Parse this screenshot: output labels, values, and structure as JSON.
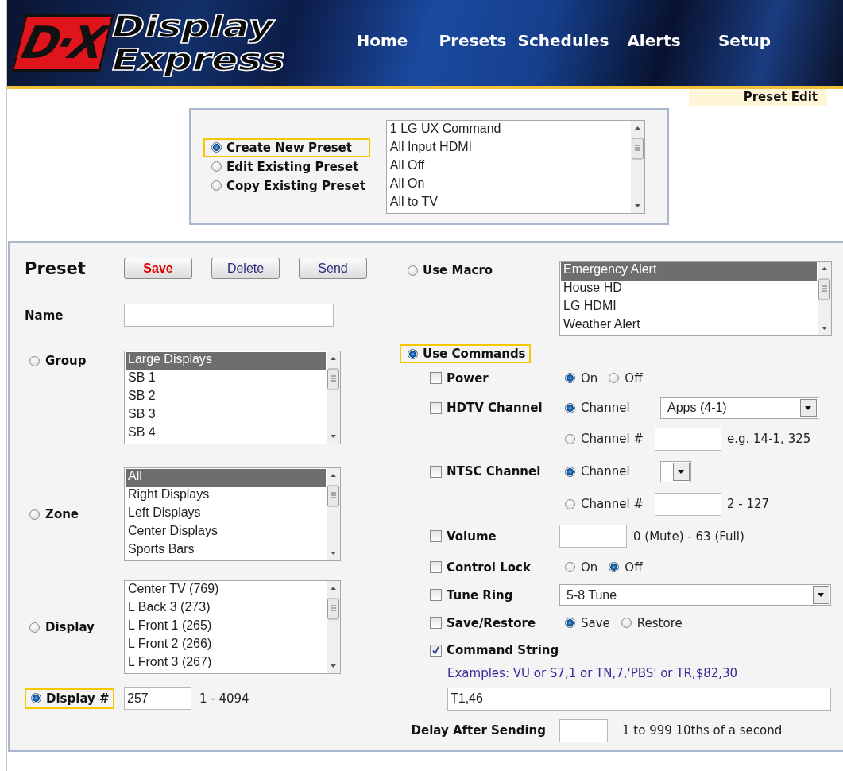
{
  "header": {
    "logo_mark": "D·X",
    "logo_text": [
      "Display",
      "Express"
    ],
    "nav": [
      "Home",
      "Presets",
      "Schedules",
      "Alerts",
      "Setup"
    ]
  },
  "page_tab": "Preset Edit",
  "mode": {
    "options": [
      {
        "label": "Create New Preset",
        "selected": true
      },
      {
        "label": "Edit Existing Preset",
        "selected": false
      },
      {
        "label": "Copy Existing Preset",
        "selected": false
      }
    ],
    "presets": [
      {
        "label": "1 LG UX Command",
        "selected": false
      },
      {
        "label": "All Input HDMI",
        "selected": false
      },
      {
        "label": "All Off",
        "selected": false
      },
      {
        "label": "All On",
        "selected": false
      },
      {
        "label": "All to TV",
        "selected": false
      }
    ]
  },
  "preset": {
    "title": "Preset",
    "buttons": [
      {
        "label": "Save",
        "kind": "danger"
      },
      {
        "label": "Delete",
        "kind": "normal"
      },
      {
        "label": "Send",
        "kind": "normal"
      }
    ],
    "name_label": "Name"
  },
  "targets": [
    {
      "kind": "list",
      "label": "Group",
      "selected": false,
      "items": [
        {
          "label": "Large Displays",
          "selected": true
        },
        {
          "label": "SB 1",
          "selected": false
        },
        {
          "label": "SB 2",
          "selected": false
        },
        {
          "label": "SB 3",
          "selected": false
        },
        {
          "label": "SB 4",
          "selected": false
        }
      ]
    },
    {
      "kind": "list",
      "label": "Zone",
      "selected": false,
      "items": [
        {
          "label": "All",
          "selected": true
        },
        {
          "label": "Right Displays",
          "selected": false
        },
        {
          "label": "Left Displays",
          "selected": false
        },
        {
          "label": "Center Displays",
          "selected": false
        },
        {
          "label": "Sports Bars",
          "selected": false
        }
      ]
    },
    {
      "kind": "list",
      "label": "Display",
      "selected": false,
      "items": [
        {
          "label": "Center TV (769)",
          "selected": false
        },
        {
          "label": "L Back 3 (273)",
          "selected": false
        },
        {
          "label": "L Front 1 (265)",
          "selected": false
        },
        {
          "label": "L Front 2 (266)",
          "selected": false
        },
        {
          "label": "L Front 3 (267)",
          "selected": false
        }
      ]
    },
    {
      "kind": "number",
      "label": "Display #",
      "selected": true,
      "value": "257",
      "hint": "1 - 4094"
    }
  ],
  "macro": {
    "label": "Use Macro",
    "selected": false,
    "items": [
      {
        "label": "Emergency Alert",
        "selected": true
      },
      {
        "label": "House HD",
        "selected": false
      },
      {
        "label": "LG HDMI",
        "selected": false
      },
      {
        "label": "Weather Alert",
        "selected": false
      }
    ]
  },
  "commands": {
    "label": "Use Commands",
    "selected": true,
    "rows": [
      {
        "kind": "radios",
        "label": "Power",
        "checked": false,
        "options": [
          {
            "label": "On",
            "selected": true
          },
          {
            "label": "Off",
            "selected": false
          }
        ]
      },
      {
        "kind": "channel",
        "label": "HDTV Channel",
        "checked": false,
        "options": [
          {
            "kind": "select",
            "label": "Channel",
            "selected": true,
            "value": "Apps (4-1)"
          },
          {
            "kind": "input",
            "label": "Channel #",
            "selected": false,
            "hint": "e.g. 14-1, 325"
          }
        ]
      },
      {
        "kind": "channel",
        "label": "NTSC Channel",
        "checked": false,
        "options": [
          {
            "kind": "select",
            "label": "Channel",
            "selected": true
          },
          {
            "kind": "input",
            "label": "Channel #",
            "selected": false,
            "hint": "2 - 127"
          }
        ]
      },
      {
        "kind": "number",
        "label": "Volume",
        "checked": false,
        "hint": "0 (Mute) - 63 (Full)"
      },
      {
        "kind": "radios",
        "label": "Control Lock",
        "checked": false,
        "options": [
          {
            "label": "On",
            "selected": false
          },
          {
            "label": "Off",
            "selected": true
          }
        ]
      },
      {
        "kind": "select",
        "label": "Tune Ring",
        "checked": false,
        "value": "5-8 Tune"
      },
      {
        "kind": "radios",
        "label": "Save/Restore",
        "checked": false,
        "options": [
          {
            "label": "Save",
            "selected": true
          },
          {
            "label": "Restore",
            "selected": false
          }
        ]
      },
      {
        "kind": "text",
        "label": "Command String",
        "checked": true,
        "hint": "Examples: VU or S7,1 or TN,7,'PBS' or TR,$82,30",
        "value": "T1,46"
      }
    ]
  },
  "delay": {
    "label": "Delay After Sending",
    "hint": "1 to 999 10ths of a second"
  }
}
